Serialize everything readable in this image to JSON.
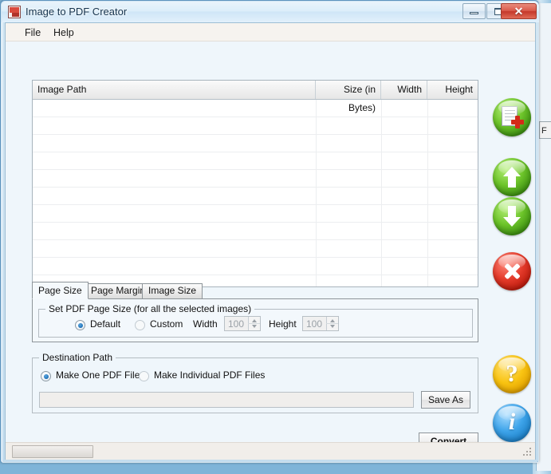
{
  "window": {
    "title": "Image to PDF Creator",
    "app_icon": "app-icon",
    "buttons": {
      "minimize": "minimize",
      "maximize": "maximize",
      "close": "✕"
    }
  },
  "menu": {
    "items": [
      {
        "label": "File"
      },
      {
        "label": "Help"
      }
    ]
  },
  "grid": {
    "columns": [
      {
        "label": "Image Path"
      },
      {
        "label": "Size (in Bytes)"
      },
      {
        "label": "Width"
      },
      {
        "label": "Height"
      }
    ],
    "rows": [],
    "empty_row_count": 11
  },
  "side_buttons": [
    {
      "name": "add-images-button",
      "icon": "add-document-icon",
      "color": "#5ab01f"
    },
    {
      "name": "move-up-button",
      "icon": "arrow-up-icon",
      "color": "#5ab01f"
    },
    {
      "name": "move-down-button",
      "icon": "arrow-down-icon",
      "color": "#5ab01f"
    },
    {
      "name": "remove-image-button",
      "icon": "close-x-icon",
      "color": "#d92c17"
    },
    {
      "name": "help-button",
      "icon": "question-mark-icon",
      "color": "#f9c412",
      "glyph": "?"
    },
    {
      "name": "info-button",
      "icon": "info-icon",
      "color": "#3ea4ea",
      "glyph": "i"
    }
  ],
  "tabs": [
    {
      "label": "Page Size",
      "active": true
    },
    {
      "label": "Page Margin",
      "active": false
    },
    {
      "label": "Image Size",
      "active": false
    }
  ],
  "page_size_panel": {
    "group_title": "Set PDF Page Size (for all the selected images)",
    "default_radio": {
      "label": "Default",
      "checked": true
    },
    "custom_radio": {
      "label": "Custom",
      "checked": false
    },
    "width_label": "Width",
    "width_value": "100",
    "height_label": "Height",
    "height_value": "100"
  },
  "destination": {
    "group_title": "Destination Path",
    "one_file_radio": {
      "label": "Make One PDF File",
      "checked": true
    },
    "individual_files_radio": {
      "label": "Make Individual PDF Files",
      "checked": false
    },
    "path_value": "",
    "path_placeholder": "",
    "save_as_label": "Save As"
  },
  "convert_label": "Convert",
  "statusbar": {
    "panel_text": "",
    "grip": "resize-grip"
  },
  "background_window": {
    "tab_hint": "F"
  }
}
